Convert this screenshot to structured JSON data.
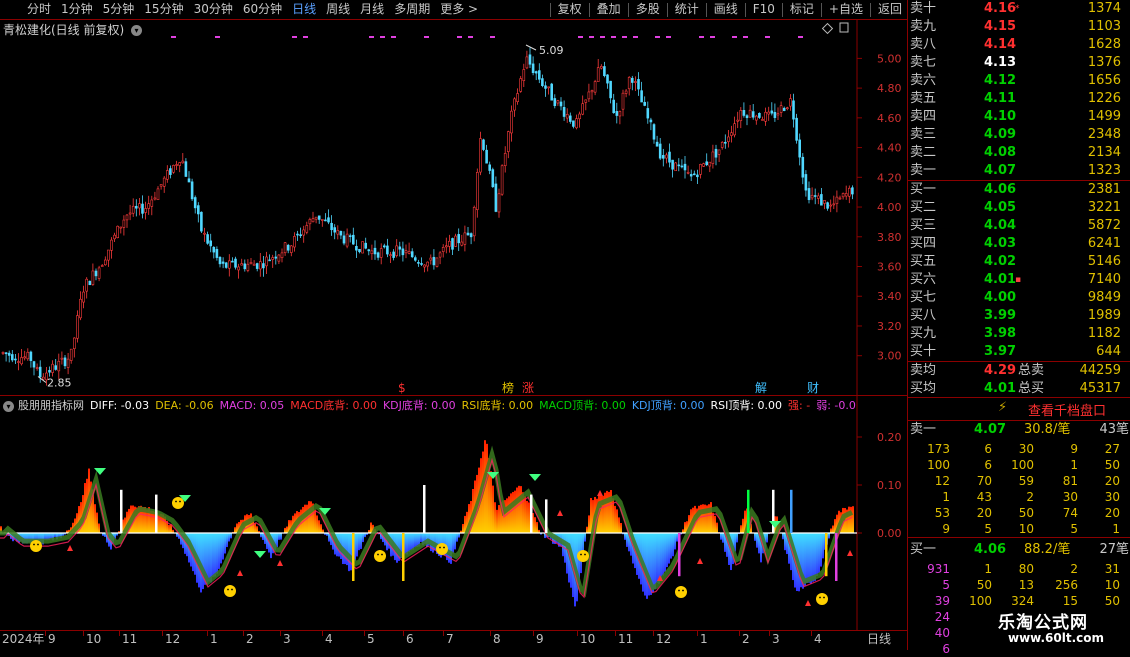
{
  "toolbar": {
    "items": [
      "分时",
      "1分钟",
      "5分钟",
      "15分钟",
      "30分钟",
      "60分钟",
      "日线",
      "周线",
      "月线",
      "多周期",
      "更多 >"
    ],
    "right_items": [
      "复权",
      "叠加",
      "多股",
      "统计",
      "画线",
      "F10",
      "标记",
      "+自选",
      "返回"
    ]
  },
  "chart": {
    "title": "青松建化(日线 前复权)",
    "y_labels": [
      "5.00",
      "4.80",
      "4.60",
      "4.40",
      "4.20",
      "4.00",
      "3.80",
      "3.60",
      "3.40",
      "3.20",
      "3.00"
    ],
    "high_label": "5.09",
    "low_label": "2.85",
    "markers": [
      {
        "text": "$",
        "color": "#ff3030"
      },
      {
        "text": "榜",
        "color": "#e0c000"
      },
      {
        "text": "涨",
        "color": "#ff3030"
      },
      {
        "text": "解",
        "color": "#40c0ff"
      },
      {
        "text": "财",
        "color": "#40c0ff"
      }
    ]
  },
  "indicator": {
    "name": "股朋朋指标网",
    "items": [
      {
        "text": "DIFF: -0.03",
        "color": "#ffffff"
      },
      {
        "text": "DEA: -0.06",
        "color": "#e0c000"
      },
      {
        "text": "MACD: 0.05",
        "color": "#e040e0"
      },
      {
        "text": "MACD底背: 0.00",
        "color": "#ff3030"
      },
      {
        "text": "KDJ底背: 0.00",
        "color": "#e040e0"
      },
      {
        "text": "RSI底背: 0.00",
        "color": "#e0c000"
      },
      {
        "text": "MACD顶背: 0.00",
        "color": "#00d000"
      },
      {
        "text": "KDJ顶背: 0.00",
        "color": "#40a0ff"
      },
      {
        "text": "RSI顶背: 0.00",
        "color": "#ffffff"
      },
      {
        "text": "强: -",
        "color": "#ff3030"
      },
      {
        "text": "弱: -0.0",
        "color": "#e040e0"
      }
    ],
    "y_labels": [
      "0.20",
      "0.10",
      "0.00"
    ]
  },
  "timeline": {
    "labels": [
      "2024年",
      "9",
      "10",
      "11",
      "12",
      "1",
      "2",
      "3",
      "4",
      "5",
      "6",
      "7",
      "8",
      "9",
      "10",
      "11",
      "12",
      "1",
      "2",
      "3",
      "4"
    ],
    "period": "日线"
  },
  "orderbook": {
    "asks": [
      {
        "name": "卖十",
        "price": "4.16",
        "vol": "1374",
        "mark": "*",
        "color": "red"
      },
      {
        "name": "卖九",
        "price": "4.15",
        "vol": "1103",
        "mark": "",
        "color": "red"
      },
      {
        "name": "卖八",
        "price": "4.14",
        "vol": "1628",
        "mark": "",
        "color": "red"
      },
      {
        "name": "卖七",
        "price": "4.13",
        "vol": "1376",
        "mark": "",
        "color": "white"
      },
      {
        "name": "卖六",
        "price": "4.12",
        "vol": "1656",
        "mark": "",
        "color": "green"
      },
      {
        "name": "卖五",
        "price": "4.11",
        "vol": "1226",
        "mark": "",
        "color": "green"
      },
      {
        "name": "卖四",
        "price": "4.10",
        "vol": "1499",
        "mark": "",
        "color": "green"
      },
      {
        "name": "卖三",
        "price": "4.09",
        "vol": "2348",
        "mark": "",
        "color": "green"
      },
      {
        "name": "卖二",
        "price": "4.08",
        "vol": "2134",
        "mark": "",
        "color": "green"
      },
      {
        "name": "卖一",
        "price": "4.07",
        "vol": "1323",
        "mark": "",
        "color": "green"
      }
    ],
    "bids": [
      {
        "name": "买一",
        "price": "4.06",
        "vol": "2381",
        "mark": "",
        "color": "green"
      },
      {
        "name": "买二",
        "price": "4.05",
        "vol": "3221",
        "mark": "",
        "color": "green"
      },
      {
        "name": "买三",
        "price": "4.04",
        "vol": "5872",
        "mark": "",
        "color": "green"
      },
      {
        "name": "买四",
        "price": "4.03",
        "vol": "6241",
        "mark": "",
        "color": "green"
      },
      {
        "name": "买五",
        "price": "4.02",
        "vol": "5146",
        "mark": "",
        "color": "green"
      },
      {
        "name": "买六",
        "price": "4.01",
        "vol": "7140",
        "mark": "▪",
        "color": "green"
      },
      {
        "name": "买七",
        "price": "4.00",
        "vol": "9849",
        "mark": "",
        "color": "green"
      },
      {
        "name": "买八",
        "price": "3.99",
        "vol": "1989",
        "mark": "",
        "color": "green"
      },
      {
        "name": "买九",
        "price": "3.98",
        "vol": "1182",
        "mark": "",
        "color": "green"
      },
      {
        "name": "买十",
        "price": "3.97",
        "vol": "644",
        "mark": "",
        "color": "green"
      }
    ],
    "avg_sell": {
      "name": "卖均",
      "price": "4.29",
      "label": "总卖",
      "vol": "44259"
    },
    "avg_buy": {
      "name": "买均",
      "price": "4.01",
      "label": "总买",
      "vol": "45317"
    },
    "link": "查看千档盘口",
    "sell1": {
      "name": "卖一",
      "price": "4.07",
      "per": "30.8/笔",
      "count": "43笔"
    },
    "sell_ticks": [
      [
        "173",
        "6",
        "30",
        "9",
        "27"
      ],
      [
        "100",
        "6",
        "100",
        "1",
        "50"
      ],
      [
        "12",
        "70",
        "59",
        "81",
        "20"
      ],
      [
        "1",
        "43",
        "2",
        "30",
        "30"
      ],
      [
        "53",
        "20",
        "50",
        "74",
        "20"
      ],
      [
        "9",
        "5",
        "10",
        "5",
        "1"
      ]
    ],
    "buy1": {
      "name": "买一",
      "price": "4.06",
      "per": "88.2/笔",
      "count": "27笔"
    },
    "buy_ticks": [
      [
        "931",
        "1",
        "80",
        "2",
        "31"
      ],
      [
        "5",
        "50",
        "13",
        "256",
        "10"
      ],
      [
        "39",
        "100",
        "324",
        "15",
        "50"
      ],
      [
        "24",
        "",
        "",
        "",
        ""
      ],
      [
        "40",
        "",
        "",
        "",
        ""
      ],
      [
        "6",
        "",
        "",
        "",
        ""
      ]
    ]
  },
  "watermark": {
    "name": "乐淘公式网",
    "url": "www.60lt.com"
  }
}
